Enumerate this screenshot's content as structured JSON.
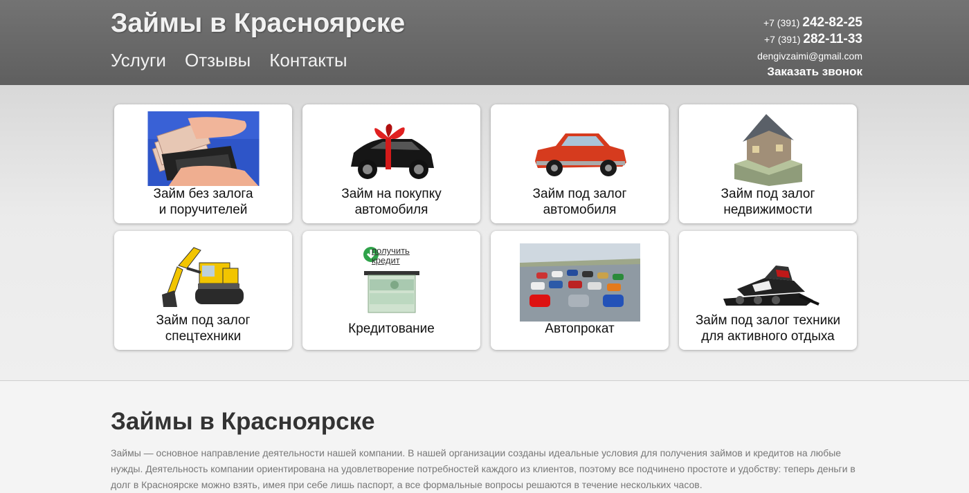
{
  "header": {
    "title": "Займы в Красноярске",
    "nav": [
      "Услуги",
      "Отзывы",
      "Контакты"
    ],
    "phones": [
      {
        "prefix": "+7 (391) ",
        "number": "242-82-25"
      },
      {
        "prefix": "+7 (391) ",
        "number": "282-11-33"
      }
    ],
    "email": "dengivzaimi@gmail.com",
    "callback_label": "Заказать звонок"
  },
  "services": [
    {
      "line1": "Займ без залога",
      "line2": "и поручителей",
      "icon": "money-wallet-icon"
    },
    {
      "line1": "Займ на покупку",
      "line2": "автомобиля",
      "icon": "gift-car-icon"
    },
    {
      "line1": "Займ под залог",
      "line2": "автомобиля",
      "icon": "red-car-icon"
    },
    {
      "line1": "Займ под залог",
      "line2": "недвижимости",
      "icon": "house-money-icon"
    },
    {
      "line1": "Займ под залог",
      "line2": "спецтехники",
      "icon": "excavator-icon"
    },
    {
      "line1": "Кредитование",
      "line2": "",
      "icon": "credit-atm-icon",
      "overlay": [
        "получить",
        "кредит"
      ]
    },
    {
      "line1": "Автопрокат",
      "line2": "",
      "icon": "car-fleet-icon"
    },
    {
      "line1": "Займ под залог техники",
      "line2": "для активного отдыха",
      "icon": "snowmobile-icon"
    }
  ],
  "content": {
    "heading": "Займы в Красноярске",
    "paragraph": "Займы — основное направление деятельности нашей компании. В нашей организации созданы идеальные условия для получения займов и кредитов на любые нужды. Деятельность компании ориентирована на удовлетворение потребностей каждого из клиентов, поэтому все подчинено простоте и удобству: теперь деньги в долг в Красноярске можно взять, имея при себе лишь паспорт, а все формальные вопросы решаются в течение нескольких часов."
  },
  "colors": {
    "header_bg": "#666666",
    "header_text": "#f2f2f2",
    "page_bg": "#f4f4f4",
    "card_bg": "#ffffff"
  }
}
